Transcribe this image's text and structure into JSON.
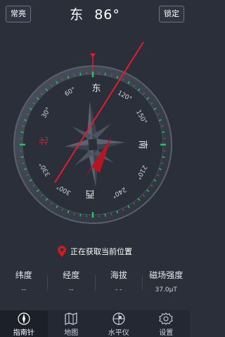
{
  "header": {
    "left_button": "常亮",
    "direction": "东",
    "degrees": "86°",
    "right_button": "锁定"
  },
  "compass": {
    "cardinals": {
      "north": "北",
      "east": "东",
      "south": "南",
      "west": "西"
    },
    "degree_labels": [
      "30°",
      "60°",
      "120°",
      "150°",
      "210°",
      "240°",
      "300°",
      "330°"
    ],
    "accent_color": "#e11d2e",
    "tick_color": "#22c55e"
  },
  "location": {
    "status": "正在获取当前位置",
    "pin_color": "#c81e1e"
  },
  "stats": [
    {
      "label": "纬度",
      "value": "--"
    },
    {
      "label": "经度",
      "value": "--"
    },
    {
      "label": "海拔",
      "value": "- -"
    },
    {
      "label": "磁场强度",
      "value": "37.0μT"
    }
  ],
  "tabs": [
    {
      "label": "指南针",
      "icon": "compass-icon"
    },
    {
      "label": "地图",
      "icon": "map-icon"
    },
    {
      "label": "水平仪",
      "icon": "level-icon"
    },
    {
      "label": "设置",
      "icon": "gear-icon"
    }
  ]
}
